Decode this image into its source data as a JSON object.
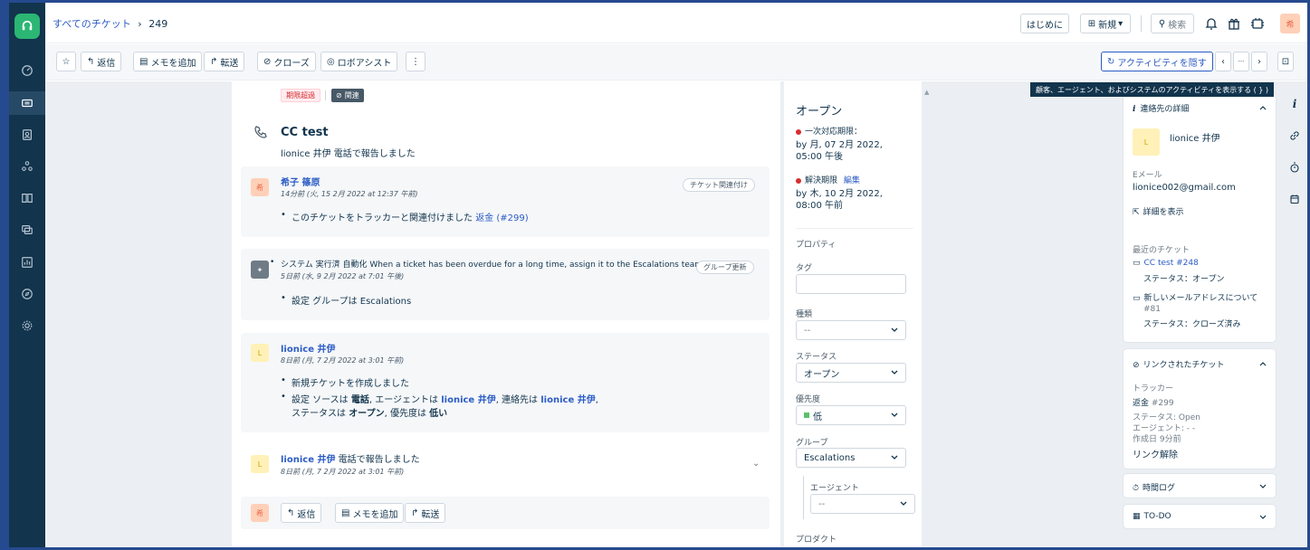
{
  "header": {
    "breadcrumb_link": "すべてのチケット",
    "breadcrumb_sep": "›",
    "ticket_no": "249",
    "start_label": "はじめに",
    "new_label": "新規",
    "search_label": "検索",
    "avatar_initial": "希"
  },
  "toolbar": {
    "reply": "返信",
    "add_note": "メモを追加",
    "forward": "転送",
    "close": "クローズ",
    "robo": "ロボアシスト",
    "more": "⋮",
    "hide_activity": "アクティビティを隠す",
    "prev": "‹",
    "ellipsis": "···",
    "next": "›",
    "tooltip": "顧客、エージェント、およびシステムのアクティビティを表示する ( } )"
  },
  "ticket": {
    "overdue_tag": "期限超過",
    "related_tag": "関連",
    "subject": "CC test",
    "submitted_by": "lionice 井伊 電話で報告しました"
  },
  "activities": [
    {
      "avatar": "希",
      "name": "希子 篠原",
      "time": "14分前 (火, 15 2月 2022 at 12:37 午前)",
      "badge": "チケット関連付け",
      "bullets": [
        {
          "text": "このチケットをトラッカーと関連付けました",
          "link": "返金 (#299)"
        }
      ]
    },
    {
      "avatar": "",
      "name": "システム 実行済 自動化 When a ticket has been overdue for a long time, assign it to the Escalations team",
      "time": "5日前 (水, 9 2月 2022 at 7:01 午後)",
      "badge": "グループ更新",
      "bullets": [
        {
          "text": "設定 グループは",
          "bold": "Escalations"
        }
      ]
    },
    {
      "avatar": "L",
      "name": "lionice 井伊",
      "time": "8日前 (月, 7 2月 2022 at 3:01 午前)",
      "bullets": [
        {
          "text": "新規チケットを作成しました"
        },
        {
          "text": "設定 ソースは",
          "b1": "電話",
          "t2": ", エージェントは",
          "l1": "lionice 井伊",
          "t3": ", 連絡先は",
          "l2": "lionice 井伊",
          "t4": ","
        },
        {
          "text": "ステータスは",
          "b1": "オープン",
          "t2": ", 優先度は",
          "b2": "低い"
        }
      ]
    },
    {
      "avatar": "L",
      "name": "lionice 井伊",
      "name_suffix": "電話で報告しました",
      "time": "8日前 (月, 7 2月 2022 at 3:01 午前)"
    }
  ],
  "reply_bar": {
    "avatar": "希",
    "reply": "返信",
    "add_note": "メモを追加",
    "forward": "転送"
  },
  "properties": {
    "status_title": "オープン",
    "first_response_label": "一次対応期限：",
    "first_response_value": "by 月, 07 2月 2022, 05:00 午後",
    "resolution_label": "解決期限",
    "resolution_edit": "編集",
    "resolution_value": "by 木, 10 2月 2022, 08:00 午前",
    "section": "プロパティ",
    "tag_label": "タグ",
    "type_label": "種類",
    "type_value": "--",
    "status_label": "ステータス",
    "status_value": "オープン",
    "priority_label": "優先度",
    "priority_value": "低",
    "priority_color": "#5cc06a",
    "group_label": "グループ",
    "group_value": "Escalations",
    "agent_label": "エージェント",
    "agent_value": "--",
    "product_label": "プロダクト"
  },
  "sidebar": {
    "contact_title": "連絡先の詳細",
    "contact_avatar": "L",
    "contact_name": "lionice 井伊",
    "email_label": "Eメール",
    "email_value": "lionice002@gmail.com",
    "show_details": "詳細を表示",
    "recent_label": "最近のチケット",
    "recent": [
      {
        "title": "CC test",
        "id": "#248",
        "status": "ステータス：オープン"
      },
      {
        "title": "新しいメールアドレスについて",
        "id": "#81",
        "status": "ステータス：クローズ済み"
      }
    ],
    "linked_title": "リンクされたチケット",
    "tracker_label": "トラッカー",
    "tracker_name": "返金",
    "tracker_id": "#299",
    "tracker_status": "ステータス: Open",
    "tracker_agent": "エージェント: - -",
    "tracker_created": "作成日 9分前",
    "unlink": "リンク解除",
    "timelog_title": "時間ログ",
    "todo_title": "TO-DO"
  }
}
